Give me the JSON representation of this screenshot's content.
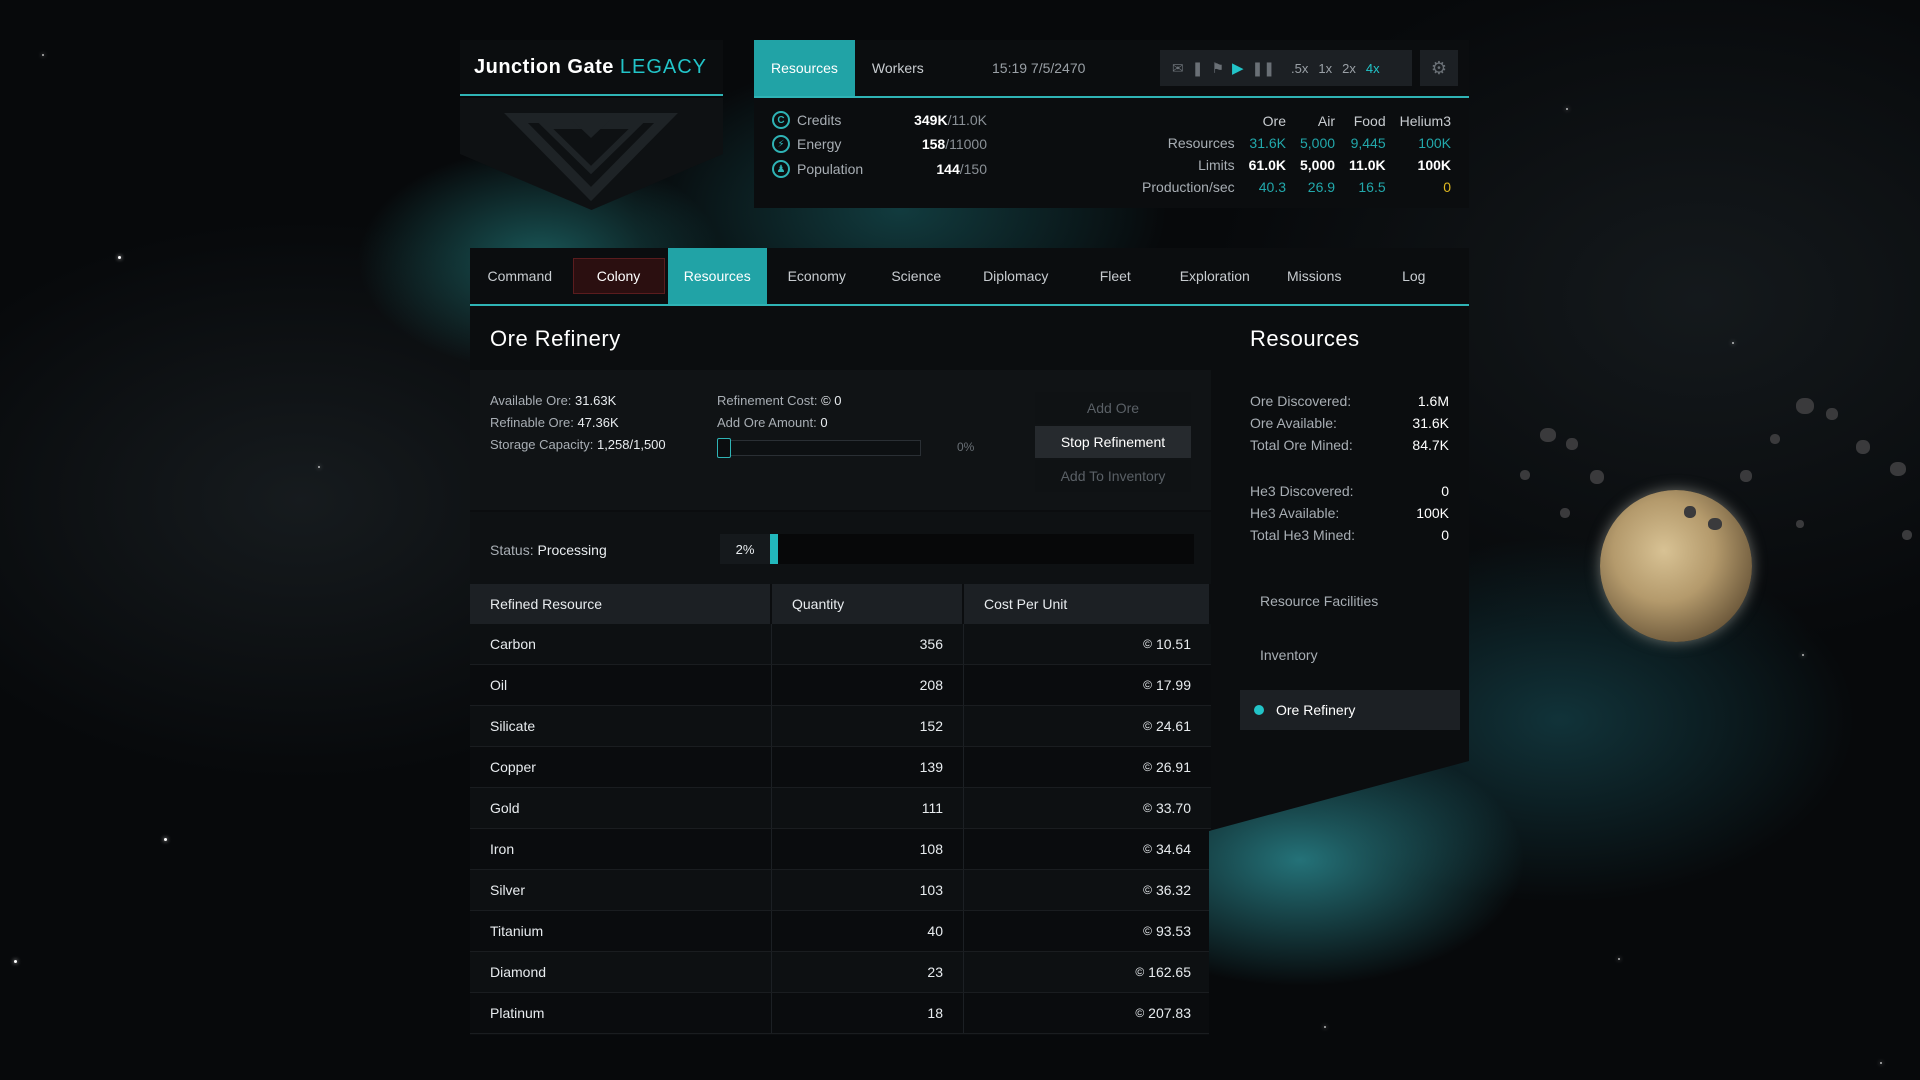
{
  "game": {
    "title": "Junction Gate",
    "title_suffix": "LEGACY"
  },
  "top_tabs": [
    {
      "label": "Resources",
      "active": true
    },
    {
      "label": "Workers",
      "active": false
    }
  ],
  "datetime": "15:19 7/5/2470",
  "speed_controls": [
    ".5x",
    "1x",
    "2x",
    "4x"
  ],
  "active_speed": "4x",
  "stats": [
    {
      "icon": "credits-icon",
      "glyph": "C",
      "label": "Credits",
      "value": "349K",
      "max": "/11.0K"
    },
    {
      "icon": "energy-icon",
      "glyph": "⚡",
      "label": "Energy",
      "value": "158",
      "max": "/11000"
    },
    {
      "icon": "population-icon",
      "glyph": "♟",
      "label": "Population",
      "value": "144",
      "max": "/150"
    }
  ],
  "resource_grid": {
    "columns": [
      "Ore",
      "Air",
      "Food",
      "Helium3"
    ],
    "rows": [
      {
        "label": "Resources",
        "values": [
          "31.6K",
          "5,000",
          "9,445",
          "100K"
        ]
      },
      {
        "label": "Limits",
        "values": [
          "61.0K",
          "5,000",
          "11.0K",
          "100K"
        ]
      },
      {
        "label": "Production/sec",
        "values": [
          "40.3",
          "26.9",
          "16.5",
          "0"
        ]
      }
    ]
  },
  "main_tabs": [
    "Command",
    "Colony",
    "Resources",
    "Economy",
    "Science",
    "Diplomacy",
    "Fleet",
    "Exploration",
    "Missions",
    "Log"
  ],
  "active_main_tab": "Resources",
  "refinery": {
    "title": "Ore Refinery",
    "available_ore_label": "Available Ore:",
    "available_ore": "31.63K",
    "refinable_ore_label": "Refinable Ore:",
    "refinable_ore": "47.36K",
    "storage_label": "Storage Capacity:",
    "storage": "1,258/1,500",
    "cost_label": "Refinement Cost:",
    "cost": "0",
    "add_amount_label": "Add Ore Amount:",
    "add_amount": "0",
    "slider_pct": "0%",
    "add_ore_button": "Add Ore",
    "stop_button": "Stop Refinement",
    "add_inventory_button": "Add To Inventory",
    "status_label": "Status:",
    "status": "Processing",
    "progress_label": "2%",
    "progress": 0.02
  },
  "table": {
    "headers": [
      "Refined Resource",
      "Quantity",
      "Cost Per Unit"
    ],
    "rows": [
      {
        "name": "Carbon",
        "qty": "356",
        "cost": "10.51"
      },
      {
        "name": "Oil",
        "qty": "208",
        "cost": "17.99"
      },
      {
        "name": "Silicate",
        "qty": "152",
        "cost": "24.61"
      },
      {
        "name": "Copper",
        "qty": "139",
        "cost": "26.91"
      },
      {
        "name": "Gold",
        "qty": "111",
        "cost": "33.70"
      },
      {
        "name": "Iron",
        "qty": "108",
        "cost": "34.64"
      },
      {
        "name": "Silver",
        "qty": "103",
        "cost": "36.32"
      },
      {
        "name": "Titanium",
        "qty": "40",
        "cost": "93.53"
      },
      {
        "name": "Diamond",
        "qty": "23",
        "cost": "162.65"
      },
      {
        "name": "Platinum",
        "qty": "18",
        "cost": "207.83"
      }
    ]
  },
  "side": {
    "title": "Resources",
    "stats": [
      {
        "label": "Ore Discovered:",
        "value": "1.6M"
      },
      {
        "label": "Ore Available:",
        "value": "31.6K"
      },
      {
        "label": "Total Ore Mined:",
        "value": "84.7K"
      },
      {
        "label": "He3 Discovered:",
        "value": "0"
      },
      {
        "label": "He3 Available:",
        "value": "100K"
      },
      {
        "label": "Total He3 Mined:",
        "value": "0"
      }
    ],
    "links": [
      "Resource Facilities",
      "Inventory"
    ],
    "active_link": "Ore Refinery"
  }
}
